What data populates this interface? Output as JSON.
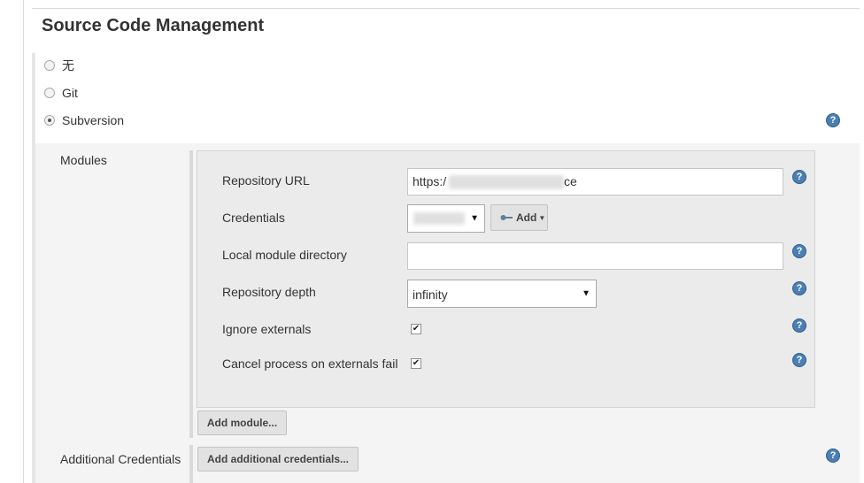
{
  "section": {
    "title": "Source Code Management"
  },
  "scm_options": [
    {
      "label": "无",
      "selected": false
    },
    {
      "label": "Git",
      "selected": false
    },
    {
      "label": "Subversion",
      "selected": true
    }
  ],
  "modules": {
    "label": "Modules",
    "repository_url": {
      "label": "Repository URL",
      "value_start": "https:/",
      "value_end": "ce"
    },
    "credentials": {
      "label": "Credentials",
      "add_label": "Add"
    },
    "local_module_directory": {
      "label": "Local module directory",
      "value": ""
    },
    "repository_depth": {
      "label": "Repository depth",
      "value": "infinity"
    },
    "ignore_externals": {
      "label": "Ignore externals",
      "checked": true
    },
    "cancel_on_externals_fail": {
      "label": "Cancel process on externals fail",
      "checked": true
    },
    "add_module_label": "Add module..."
  },
  "additional_credentials": {
    "label": "Additional Credentials",
    "button_label": "Add additional credentials..."
  },
  "icons": {
    "help": "help-question-icon",
    "dropdown": "dropdown-caret-icon",
    "key": "key-icon",
    "check": "checkmark-icon"
  },
  "colors": {
    "help_icon": "#4b7fb3",
    "panel_bg": "#f4f4f4",
    "module_bg": "#ebebeb"
  }
}
